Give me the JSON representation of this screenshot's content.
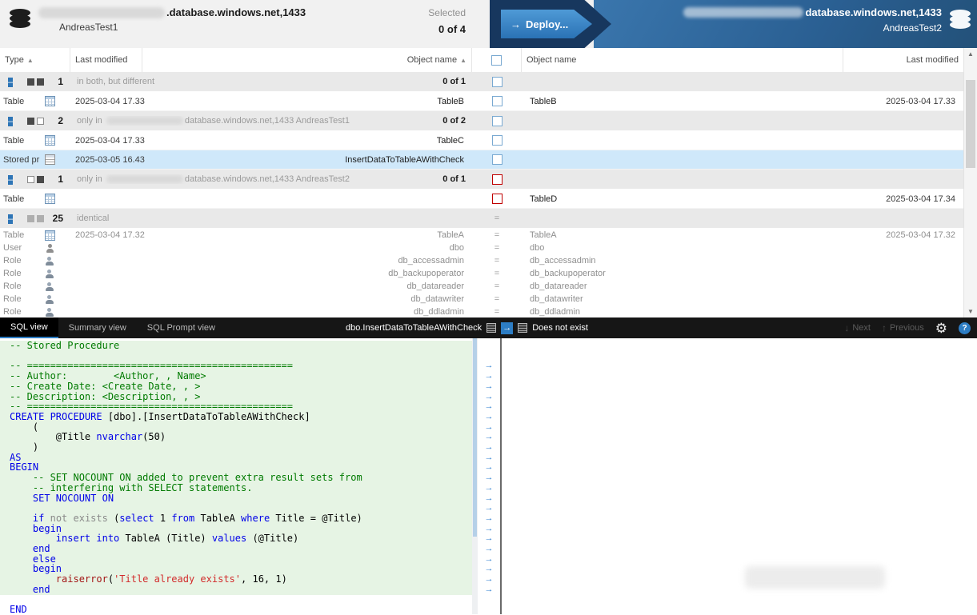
{
  "icons": {
    "collapse": "–",
    "sort_asc": "▲",
    "diff_arrow": "→",
    "deploy_arrow": "→",
    "next_arrow": "↓",
    "prev_arrow": "↑",
    "gear": "⚙",
    "help": "?",
    "scroll_up": "▲",
    "scroll_down": "▼"
  },
  "header": {
    "left": {
      "server_suffix": ".database.windows.net,1433",
      "db": "AndreasTest1"
    },
    "selected_label": "Selected",
    "selected_count": "0 of 4",
    "deploy_label": "Deploy...",
    "right": {
      "server_suffix": "database.windows.net,1433",
      "db": "AndreasTest2"
    }
  },
  "columns": {
    "type": "Type",
    "lm_left": "Last modified",
    "name_left": "Object name",
    "name_right": "Object name",
    "lm_right": "Last modified"
  },
  "grid": {
    "g0": {
      "count": "1",
      "label": "in both, but different",
      "sel": "0 of 1"
    },
    "g1": {
      "count": "2",
      "label_prefix": "only in ",
      "label_suffix": "database.windows.net,1433 AndreasTest1",
      "sel": "0 of 2"
    },
    "g2": {
      "count": "1",
      "label_prefix": "only in ",
      "label_suffix": "database.windows.net,1433 AndreasTest2",
      "sel": "0 of 1"
    },
    "g3": {
      "count": "25",
      "label": "identical",
      "eq": "="
    },
    "rows": [
      {
        "type": "Table",
        "lm_left": "2025-03-04 17.33",
        "name_left": "TableB",
        "name_right": "TableB",
        "lm_right": "2025-03-04 17.33"
      },
      {
        "type": "Table",
        "lm_left": "2025-03-04 17.33",
        "name_left": "TableC"
      },
      {
        "type": "Stored pr",
        "lm_left": "2025-03-05 16.43",
        "name_left": "InsertDataToTableAWithCheck"
      },
      {
        "type": "Table",
        "name_right": "TableD",
        "lm_right": "2025-03-04 17.34"
      },
      {
        "type": "Table",
        "lm_left": "2025-03-04 17.32",
        "name_left": "TableA",
        "eq": "=",
        "name_right": "TableA",
        "lm_right": "2025-03-04 17.32"
      },
      {
        "type": "User",
        "name_left": "dbo",
        "eq": "=",
        "name_right": "dbo"
      },
      {
        "type": "Role",
        "name_left": "db_accessadmin",
        "eq": "=",
        "name_right": "db_accessadmin"
      },
      {
        "type": "Role",
        "name_left": "db_backupoperator",
        "eq": "=",
        "name_right": "db_backupoperator"
      },
      {
        "type": "Role",
        "name_left": "db_datareader",
        "eq": "=",
        "name_right": "db_datareader"
      },
      {
        "type": "Role",
        "name_left": "db_datawriter",
        "eq": "=",
        "name_right": "db_datawriter"
      },
      {
        "type": "Role",
        "name_left": "db_ddladmin",
        "eq": "=",
        "name_right": "db_ddladmin"
      }
    ]
  },
  "bottom_bar": {
    "tabs": [
      "SQL view",
      "Summary view",
      "SQL Prompt view"
    ],
    "object_left": "dbo.InsertDataToTableAWithCheck",
    "object_right": "Does not exist",
    "next": "Next",
    "previous": "Previous"
  },
  "code": {
    "lines": [
      {
        "bg": "add",
        "arrow": false,
        "segs": [
          [
            "c",
            "-- Stored Procedure"
          ]
        ]
      },
      {
        "bg": "add",
        "arrow": false,
        "segs": []
      },
      {
        "bg": "add",
        "arrow": true,
        "segs": [
          [
            "c",
            "-- =============================================="
          ]
        ]
      },
      {
        "bg": "add",
        "arrow": true,
        "segs": [
          [
            "c",
            "-- Author:        <Author, , Name>"
          ]
        ]
      },
      {
        "bg": "add",
        "arrow": true,
        "segs": [
          [
            "c",
            "-- Create Date: <Create Date, , >"
          ]
        ]
      },
      {
        "bg": "add",
        "arrow": true,
        "segs": [
          [
            "c",
            "-- Description: <Description, , >"
          ]
        ]
      },
      {
        "bg": "add",
        "arrow": true,
        "segs": [
          [
            "c",
            "-- =============================================="
          ]
        ]
      },
      {
        "bg": "add",
        "arrow": true,
        "segs": [
          [
            "k",
            "CREATE PROCEDURE"
          ],
          [
            "d",
            " [dbo].[InsertDataToTableAWithCheck]"
          ]
        ]
      },
      {
        "bg": "add",
        "arrow": true,
        "segs": [
          [
            "d",
            "    ("
          ]
        ]
      },
      {
        "bg": "add",
        "arrow": true,
        "segs": [
          [
            "d",
            "        @Title "
          ],
          [
            "k",
            "nvarchar"
          ],
          [
            "d",
            "(50)"
          ]
        ]
      },
      {
        "bg": "add",
        "arrow": true,
        "segs": [
          [
            "d",
            "    )"
          ]
        ]
      },
      {
        "bg": "add",
        "arrow": true,
        "segs": [
          [
            "k",
            "AS"
          ]
        ]
      },
      {
        "bg": "add",
        "arrow": true,
        "segs": [
          [
            "k",
            "BEGIN"
          ]
        ]
      },
      {
        "bg": "add",
        "arrow": true,
        "segs": [
          [
            "c",
            "    -- SET NOCOUNT ON added to prevent extra result sets from"
          ]
        ]
      },
      {
        "bg": "add",
        "arrow": true,
        "segs": [
          [
            "c",
            "    -- interfering with SELECT statements."
          ]
        ]
      },
      {
        "bg": "add",
        "arrow": true,
        "segs": [
          [
            "d",
            "    "
          ],
          [
            "k",
            "SET NOCOUNT ON"
          ]
        ]
      },
      {
        "bg": "add",
        "arrow": true,
        "segs": []
      },
      {
        "bg": "add",
        "arrow": true,
        "segs": [
          [
            "d",
            "    "
          ],
          [
            "k",
            "if"
          ],
          [
            "d",
            " "
          ],
          [
            "g",
            "not exists"
          ],
          [
            "d",
            " ("
          ],
          [
            "k",
            "select"
          ],
          [
            "d",
            " 1 "
          ],
          [
            "k",
            "from"
          ],
          [
            "d",
            " TableA "
          ],
          [
            "k",
            "where"
          ],
          [
            "d",
            " Title = @Title)"
          ]
        ]
      },
      {
        "bg": "add",
        "arrow": true,
        "segs": [
          [
            "d",
            "    "
          ],
          [
            "k",
            "begin"
          ]
        ]
      },
      {
        "bg": "add",
        "arrow": true,
        "segs": [
          [
            "d",
            "        "
          ],
          [
            "k",
            "insert into"
          ],
          [
            "d",
            " TableA (Title) "
          ],
          [
            "k",
            "values"
          ],
          [
            "d",
            " (@Title)"
          ]
        ]
      },
      {
        "bg": "add",
        "arrow": true,
        "segs": [
          [
            "d",
            "    "
          ],
          [
            "k",
            "end"
          ]
        ]
      },
      {
        "bg": "add",
        "arrow": true,
        "segs": [
          [
            "d",
            "    "
          ],
          [
            "k",
            "else"
          ]
        ]
      },
      {
        "bg": "add",
        "arrow": true,
        "segs": [
          [
            "d",
            "    "
          ],
          [
            "k",
            "begin"
          ]
        ]
      },
      {
        "bg": "add",
        "arrow": true,
        "segs": [
          [
            "d",
            "        "
          ],
          [
            "m",
            "raiserror"
          ],
          [
            "d",
            "("
          ],
          [
            "s",
            "'Title already exists'"
          ],
          [
            "d",
            ", 16, 1)"
          ]
        ]
      },
      {
        "bg": "add",
        "arrow": true,
        "segs": [
          [
            "d",
            "    "
          ],
          [
            "k",
            "end"
          ]
        ]
      },
      {
        "bg": "plain",
        "arrow": false,
        "segs": []
      },
      {
        "bg": "plain",
        "arrow": false,
        "segs": [
          [
            "k",
            "END"
          ]
        ]
      }
    ]
  }
}
